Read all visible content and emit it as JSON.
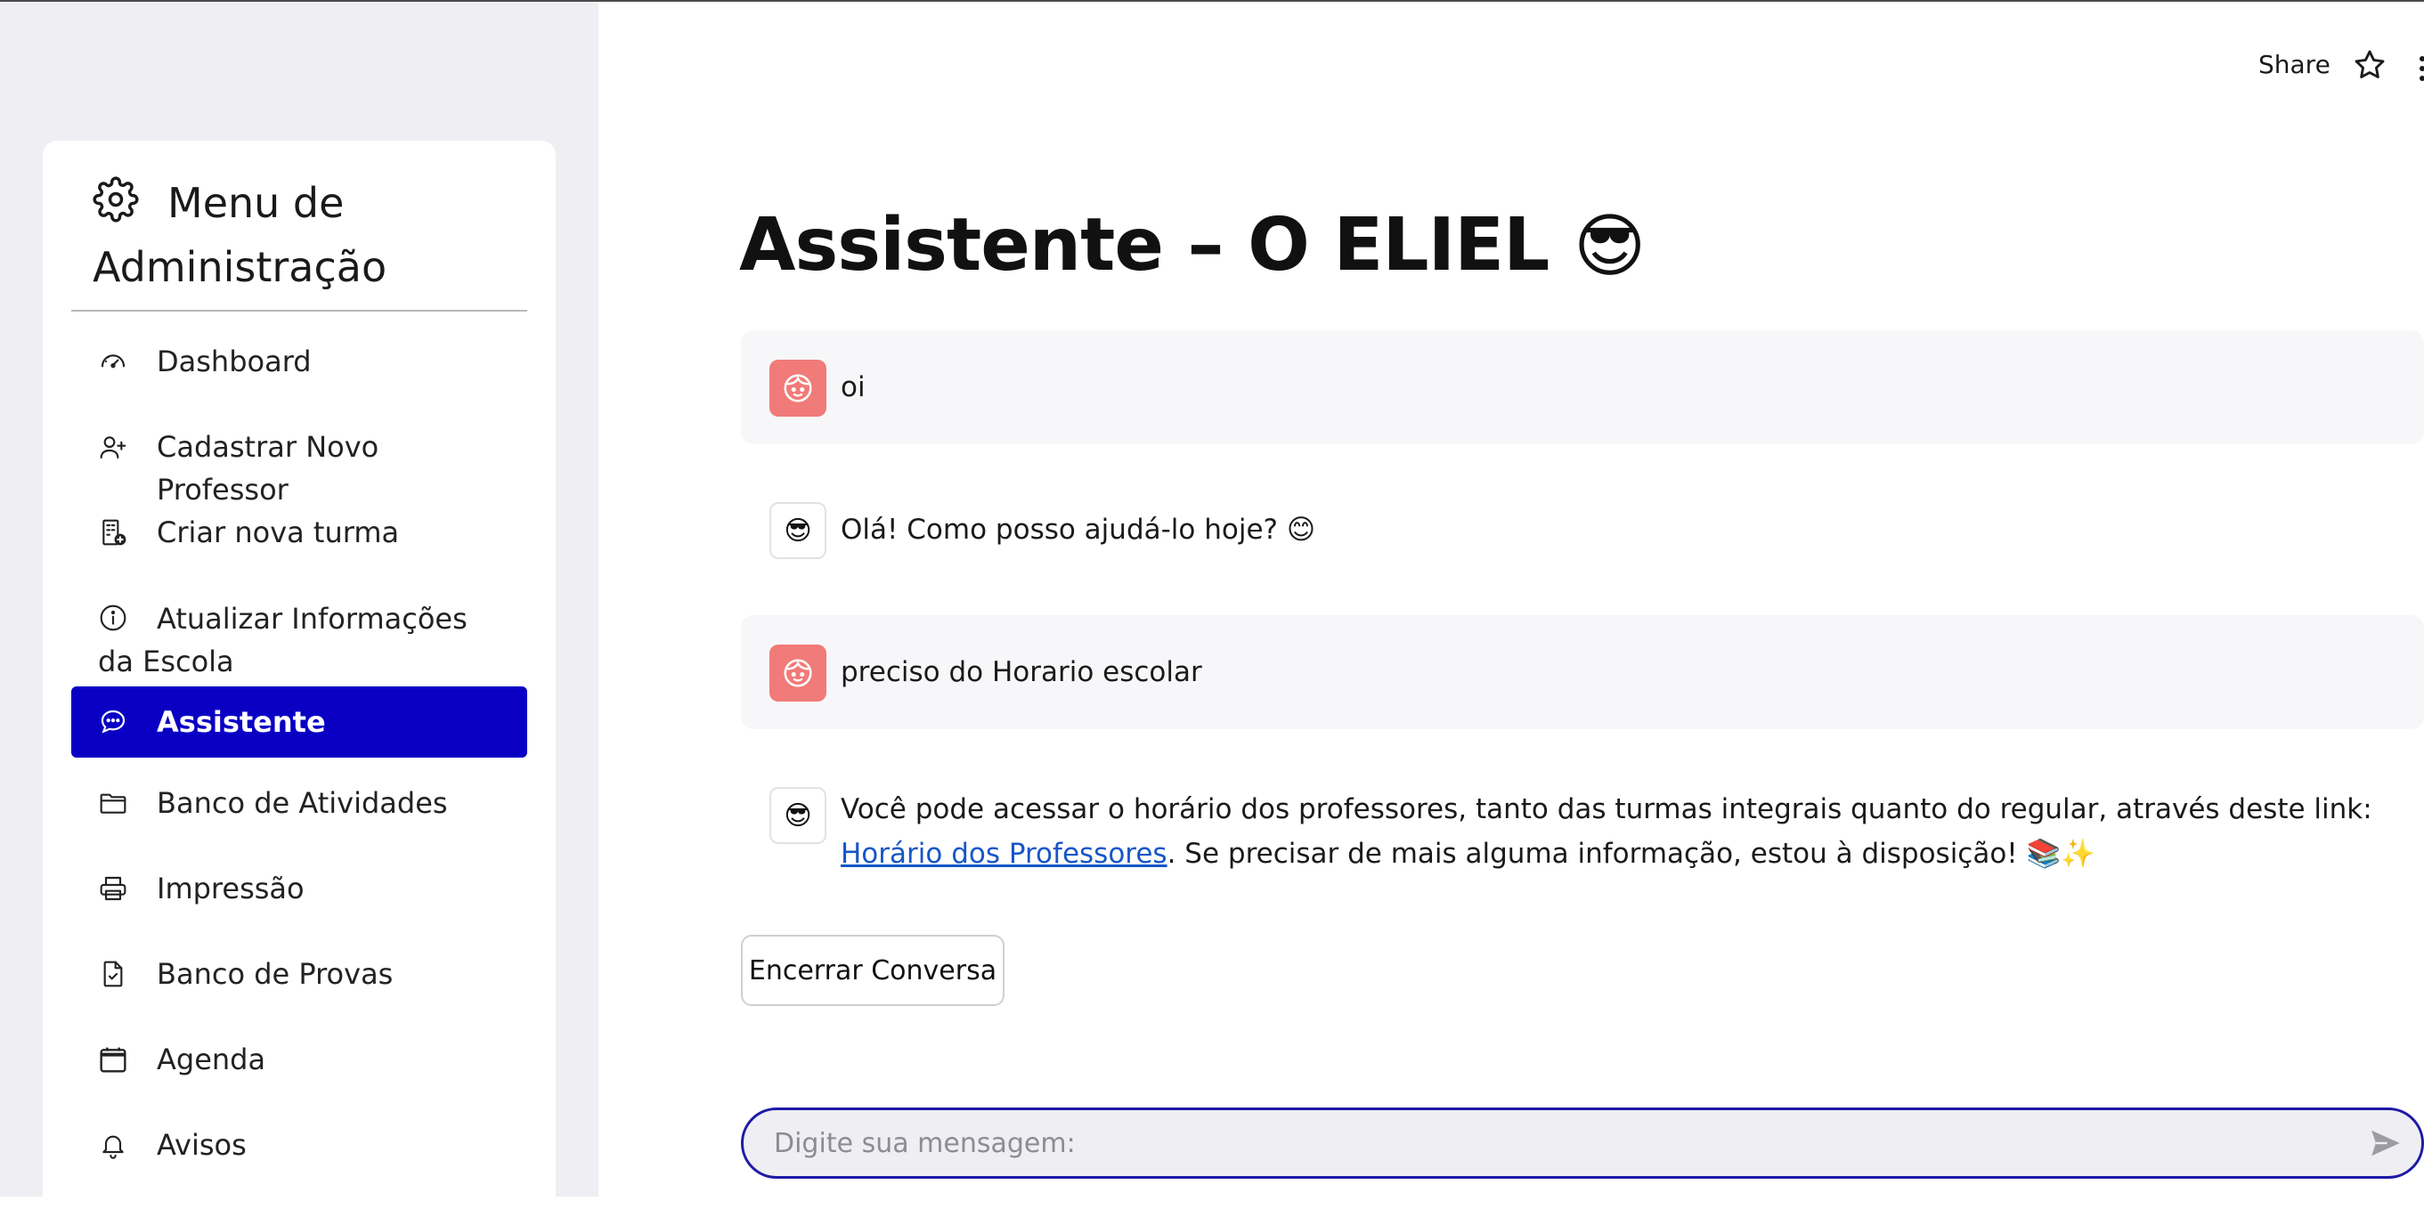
{
  "sidebar": {
    "title": "Menu de Administração",
    "items": [
      {
        "label": "Dashboard",
        "icon": "gauge-icon"
      },
      {
        "label": "Cadastrar Novo Professor",
        "icon": "person-add-icon"
      },
      {
        "label": "Criar nova turma",
        "icon": "building-add-icon"
      },
      {
        "label": "Atualizar Informações da Escola",
        "icon": "info-icon"
      },
      {
        "label": "Assistente",
        "icon": "chat-icon",
        "active": true
      },
      {
        "label": "Banco de Atividades",
        "icon": "folder-icon"
      },
      {
        "label": "Impressão",
        "icon": "printer-icon"
      },
      {
        "label": "Banco de Provas",
        "icon": "file-check-icon"
      },
      {
        "label": "Agenda",
        "icon": "calendar-icon"
      },
      {
        "label": "Avisos",
        "icon": "bell-icon"
      }
    ],
    "active_color": "#0a00c4"
  },
  "header": {
    "share_label": "Share"
  },
  "main": {
    "title": "Assistente – O ELIEL",
    "title_emoji": "😎",
    "messages": [
      {
        "role": "user",
        "text": "oi"
      },
      {
        "role": "assistant",
        "avatar": "😎",
        "text": "Olá! Como posso ajudá-lo hoje? 😊"
      },
      {
        "role": "user",
        "text": "preciso do Horario escolar"
      },
      {
        "role": "assistant",
        "avatar": "😎",
        "text_before": "Você pode acessar o horário dos professores, tanto das turmas integrais quanto do regular, através deste link: ",
        "link_text": "Horário dos Professores",
        "text_after": ". Se precisar de mais alguma informação, estou à disposição! 📚✨"
      }
    ],
    "end_button": "Encerrar Conversa",
    "input_placeholder": "Digite sua mensagem:",
    "user_avatar_color": "#f07b78",
    "link_color": "#1656c8"
  }
}
